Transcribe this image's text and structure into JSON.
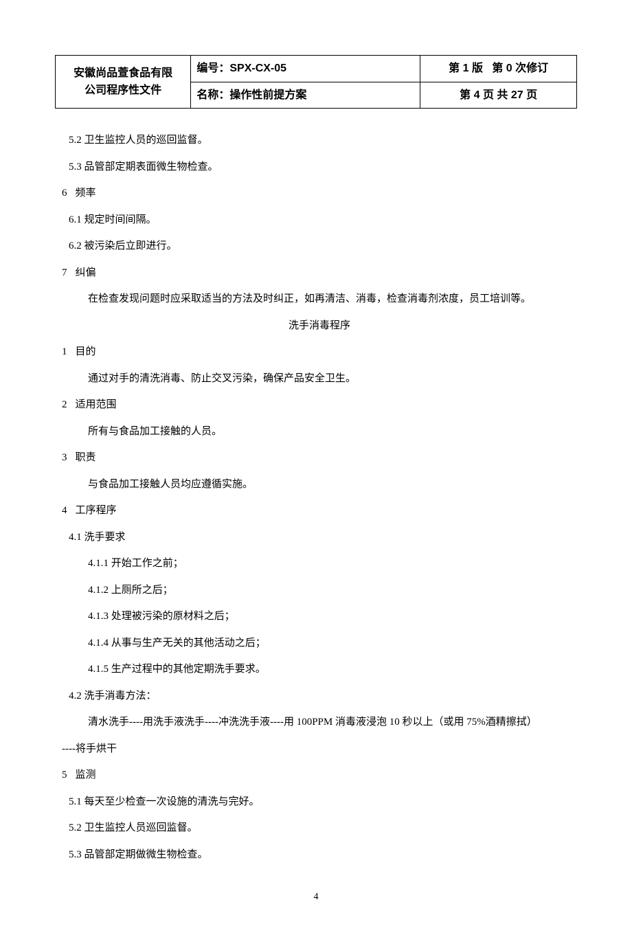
{
  "header": {
    "company_line1": "安徽尚品萱食品有限",
    "company_line2": "公司程序性文件",
    "doc_number_label": "编号：",
    "doc_number": "SPX-CX-05",
    "doc_name_label": "名称：",
    "doc_name": "操作性前提方案",
    "version": "第 1 版",
    "revision": "第 0 次修订",
    "page_info": "第 4 页 共 27 页"
  },
  "body": {
    "l5_2": "5.2 卫生监控人员的巡回监督。",
    "l5_3": "5.3 品管部定期表面微生物检查。",
    "s6_no": "6",
    "s6_title": "频率",
    "l6_1": "6.1 规定时间间隔。",
    "l6_2": "6.2 被污染后立即进行。",
    "s7_no": "7",
    "s7_title": "纠偏",
    "l7_body": "在检查发现问题时应采取适当的方法及时纠正，如再清洁、消毒，检查消毒剂浓度，员工培训等。",
    "prog_title": "洗手消毒程序",
    "p1_no": "1",
    "p1_title": "目的",
    "p1_body": "通过对手的清洗消毒、防止交叉污染，确保产品安全卫生。",
    "p2_no": "2",
    "p2_title": "适用范围",
    "p2_body": "所有与食品加工接触的人员。",
    "p3_no": "3",
    "p3_title": "职责",
    "p3_body": "与食品加工接触人员均应遵循实施。",
    "p4_no": "4",
    "p4_title": "工序程序",
    "l4_1": "4.1 洗手要求",
    "l4_1_1": "4.1.1 开始工作之前；",
    "l4_1_2": "4.1.2 上厕所之后；",
    "l4_1_3": "4.1.3 处理被污染的原材料之后；",
    "l4_1_4": "4.1.4 从事与生产无关的其他活动之后；",
    "l4_1_5": "4.1.5 生产过程中的其他定期洗手要求。",
    "l4_2": "4.2 洗手消毒方法：",
    "l4_2_body1": "清水洗手----用洗手液洗手----冲洗洗手液----用 100PPM 消毒液浸泡 10 秒以上（或用 75%酒精擦拭）",
    "l4_2_body2": "----将手烘干",
    "p5_no": "5",
    "p5_title": "监测",
    "l5b_1": "5.1 每天至少检查一次设施的清洗与完好。",
    "l5b_2": "5.2 卫生监控人员巡回监督。",
    "l5b_3": "5.3 品管部定期做微生物检查。"
  },
  "footer": {
    "page_number": "4"
  }
}
